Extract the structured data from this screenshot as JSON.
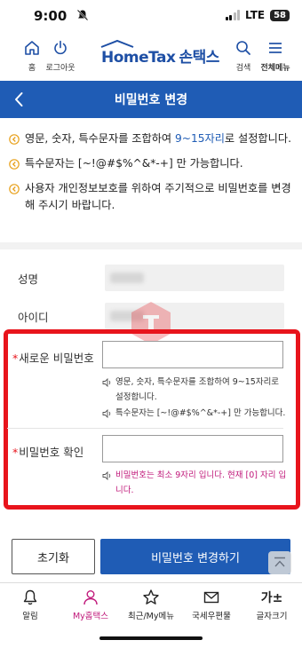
{
  "status_bar": {
    "time": "9:00",
    "network": "LTE",
    "battery": "58"
  },
  "header": {
    "home_label": "홈",
    "logout_label": "로그아웃",
    "logo_en": "HomeTax",
    "logo_ko": "손택스",
    "search_label": "검색",
    "menu_label": "전체메뉴"
  },
  "title_bar": {
    "title": "비밀번호 변경"
  },
  "notices": [
    {
      "pre": "영문, 숫자, 특수문자를 조합하여 ",
      "hl": "9~15자리",
      "post": "로 설정합니다."
    },
    {
      "pre": "특수문자는 [~!@#$%^&*-+] 만 가능합니다.",
      "hl": "",
      "post": ""
    },
    {
      "pre": "사용자 개인정보보호를 위하여 주기적으로 비밀번호를 변경해 주시기 바랍니다.",
      "hl": "",
      "post": ""
    }
  ],
  "user_info": {
    "name_label": "성명",
    "id_label": "아이디"
  },
  "new_password": {
    "required_mark": "*",
    "label": "새로운 비밀번호",
    "value": "",
    "hint_1": "영문, 숫자, 특수문자를 조합하여 9~15자리로 설정합니다.",
    "hint_2": "특수문자는 [~!@#$%^&*-+] 만 가능합니다."
  },
  "confirm_password": {
    "required_mark": "*",
    "label": "비밀번호 확인",
    "value": "",
    "error": "비밀번호는 최소 9자리 입니다. 현재 [0] 자리 입니다."
  },
  "buttons": {
    "reset": "초기화",
    "submit": "비밀번호 변경하기"
  },
  "bottom_nav": [
    {
      "label": "알림",
      "icon": "bell-icon"
    },
    {
      "label": "My홈택스",
      "icon": "person-icon"
    },
    {
      "label": "최근/My메뉴",
      "icon": "star-icon"
    },
    {
      "label": "국세우편물",
      "icon": "mail-icon"
    },
    {
      "label": "글자크기",
      "icon": "font-size-icon",
      "glyph": "가±"
    }
  ],
  "colors": {
    "primary": "#1f5cb5",
    "alert": "#e8141c",
    "active_nav": "#c0187a",
    "notice_icon": "#e8a01a"
  }
}
